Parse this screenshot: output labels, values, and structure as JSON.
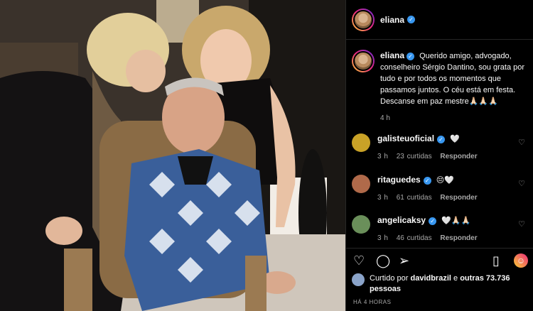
{
  "post": {
    "author": "eliana",
    "caption": "Querido amigo, advogado, conselheiro Sérgio Dantino, sou grata por tudo e por todos os momentos que passamos juntos. O céu está em festa. Descanse em paz mestre🙏🏻🙏🏻🙏🏻",
    "caption_time": "4 h",
    "liked_by_prefix": "Curtido por",
    "liked_by_user": "davidbrazil",
    "liked_by_suffix": "e",
    "liked_by_others": "outras 73.736 pessoas",
    "timestamp": "HÁ 4 HORAS"
  },
  "comments": [
    {
      "username": "galisteuoficial",
      "text": "🤍",
      "time": "3 h",
      "likes": "23 curtidas",
      "reply": "Responder",
      "avatar_color": "#c9a227"
    },
    {
      "username": "ritaguedes",
      "text": "😔🤍",
      "time": "3 h",
      "likes": "61 curtidas",
      "reply": "Responder",
      "avatar_color": "#b06a4a"
    },
    {
      "username": "angelicaksy",
      "text": "🤍🙏🏻🙏🏻",
      "time": "3 h",
      "likes": "46 curtidas",
      "reply": "Responder",
      "avatar_color": "#6a8f5a"
    }
  ],
  "icons": {
    "verified": "verified-badge-icon",
    "like": "heart-icon",
    "comment": "comment-icon",
    "share": "send-icon",
    "save": "bookmark-icon",
    "emoji": "emoji-icon"
  },
  "colors": {
    "background": "#000000",
    "link": "#3897f0",
    "muted": "#a8a8a8"
  }
}
